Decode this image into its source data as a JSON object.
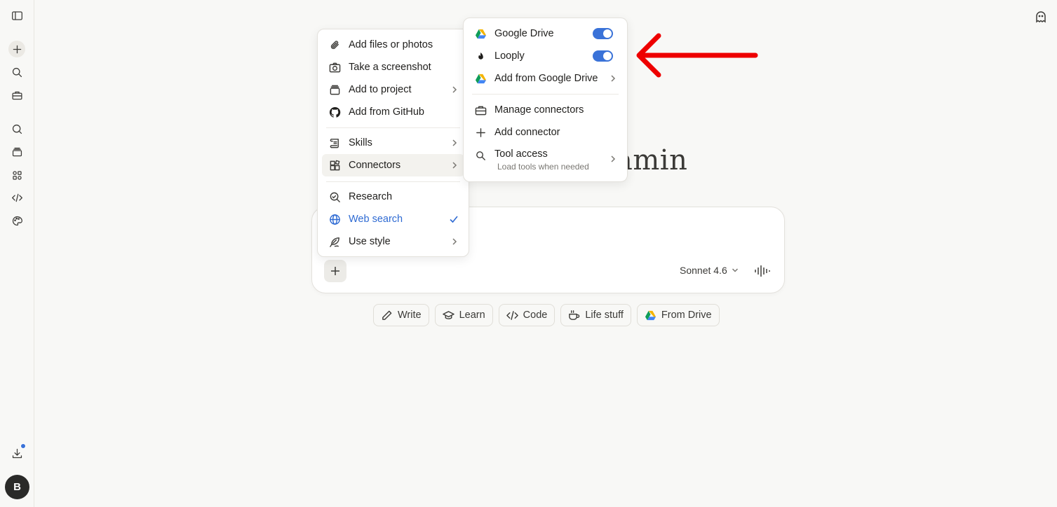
{
  "sidebar": {
    "icons": [
      "sidebar-toggle-icon",
      "new-chat-icon",
      "search-icon",
      "toolbox-icon",
      "chats-icon",
      "projects-icon",
      "artifacts-icon",
      "code-icon",
      "palette-icon",
      "download-icon"
    ],
    "avatar_initial": "B"
  },
  "header": {
    "ghost_icon": "incognito-ghost-icon"
  },
  "greeting": {
    "text": "amin"
  },
  "composer": {
    "model": "Sonnet 4.6",
    "plus_icon": "plus-icon",
    "voice_icon": "voice-waveform-icon"
  },
  "chips": [
    {
      "label": "Write",
      "icon": "pencil-icon"
    },
    {
      "label": "Learn",
      "icon": "graduation-cap-icon"
    },
    {
      "label": "Code",
      "icon": "code-icon"
    },
    {
      "label": "Life stuff",
      "icon": "coffee-cup-icon"
    },
    {
      "label": "From Drive",
      "icon": "google-drive-icon"
    }
  ],
  "attach_menu": {
    "items": [
      {
        "label": "Add files or photos",
        "icon": "paperclip-icon"
      },
      {
        "label": "Take a screenshot",
        "icon": "camera-icon"
      },
      {
        "label": "Add to project",
        "icon": "project-icon",
        "submenu": true
      },
      {
        "label": "Add from GitHub",
        "icon": "github-icon"
      },
      {
        "label": "Skills",
        "icon": "scroll-icon",
        "submenu": true
      },
      {
        "label": "Connectors",
        "icon": "connectors-icon",
        "submenu": true,
        "active": true
      },
      {
        "label": "Research",
        "icon": "research-icon"
      },
      {
        "label": "Web search",
        "icon": "globe-icon",
        "checked": true
      },
      {
        "label": "Use style",
        "icon": "feather-icon",
        "submenu": true
      }
    ]
  },
  "connectors_menu": {
    "items": [
      {
        "label": "Google Drive",
        "icon": "google-drive-icon",
        "toggle": true
      },
      {
        "label": "Looply",
        "icon": "flame-icon",
        "toggle": true
      },
      {
        "label": "Add from Google Drive",
        "icon": "google-drive-icon",
        "submenu": true
      },
      {
        "label": "Manage connectors",
        "icon": "toolbox-icon"
      },
      {
        "label": "Add connector",
        "icon": "plus-icon"
      },
      {
        "label": "Tool access",
        "sublabel": "Load tools when needed",
        "icon": "search-icon",
        "submenu": true
      }
    ]
  },
  "colors": {
    "accent": "#3a72d8",
    "annotation_arrow": "#ee0000"
  }
}
